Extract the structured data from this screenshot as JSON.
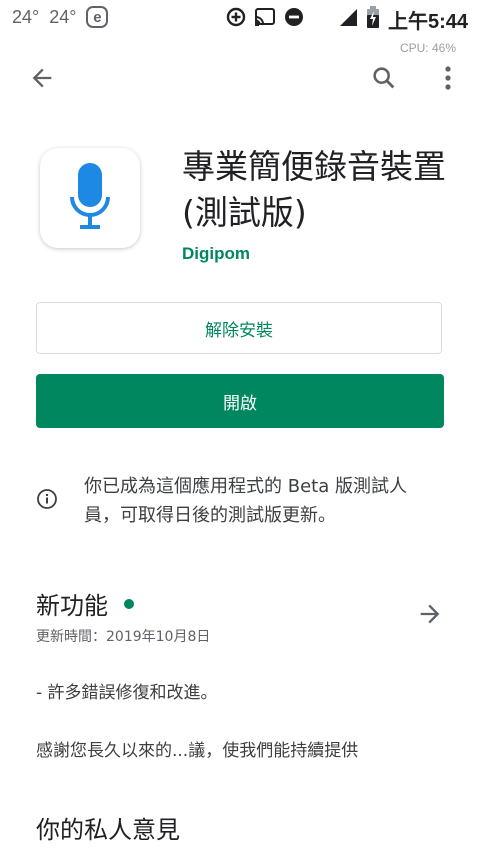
{
  "status_bar": {
    "temp1": "24°",
    "temp2": "24°",
    "e_badge": "e",
    "time": "上午5:44",
    "cpu": "CPU: 46%",
    "icons": [
      "data-saver-icon",
      "cast-icon",
      "do-not-disturb-icon",
      "signal-icon",
      "battery-icon"
    ]
  },
  "appbar": {
    "icons": [
      "back-arrow-icon",
      "search-icon",
      "more-vert-icon"
    ]
  },
  "app": {
    "title": "專業簡便錄音裝置 (測試版)",
    "developer": "Digipom",
    "icon": "microphone-icon",
    "icon_color": "#1e88e5"
  },
  "buttons": {
    "uninstall": "解除安裝",
    "open": "開啟"
  },
  "beta_notice": {
    "icon": "info-icon",
    "text": "你已成為這個應用程式的 Beta 版測試人員，可取得日後的測試版更新。"
  },
  "whats_new": {
    "title": "新功能",
    "date": "更新時間：2019年10月8日",
    "line1": "- 許多錯誤修復和改進。",
    "line2": "感謝您長久以來的...議，使我們能持續提供"
  },
  "review": {
    "title": "你的私人意見"
  },
  "colors": {
    "accent": "#01875f"
  }
}
